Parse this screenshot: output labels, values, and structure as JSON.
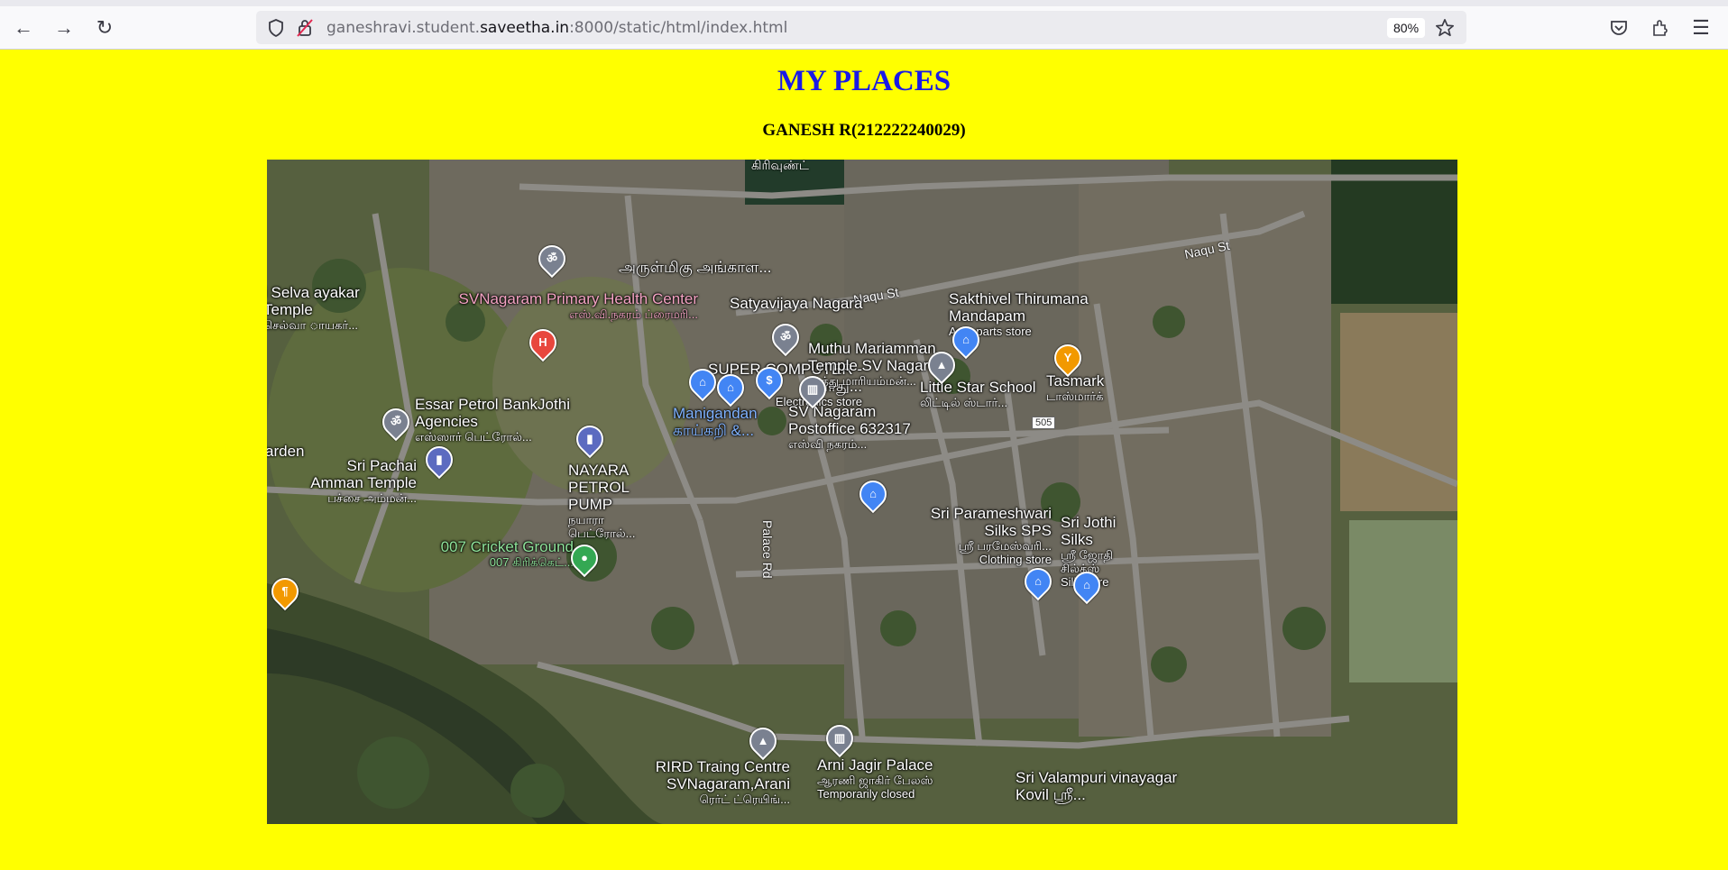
{
  "browser": {
    "url_prefix": "ganeshravi.student.",
    "url_domain": "saveetha.in",
    "url_suffix": ":8000/static/html/index.html",
    "zoom": "80%"
  },
  "page": {
    "title": "MY PLACES",
    "subtitle": "GANESH R(212222240029)"
  },
  "map": {
    "places": [
      {
        "name": "அருள்மிகு அங்காள...",
        "icon": "temple"
      },
      {
        "name": "SVNagaram Primary Health Center",
        "local": "எஸ்.வி.நகரம் ப்ரைமரி...",
        "icon": "hospital"
      },
      {
        "name": "Satyavijaya Nagara",
        "icon": "none"
      },
      {
        "name": "SUPER COMPUTER - பொது...",
        "category": "Electronics store",
        "icon": "shop"
      },
      {
        "name": "Muthu Mariamman Temple SV Nagaram",
        "local": "முத்து மாரியம்மன்...",
        "icon": "temple"
      },
      {
        "name": "Sakthivel Thirumana Mandapam",
        "category": "Auto parts store",
        "icon": "shop"
      },
      {
        "name": "Tasmark",
        "local": "டாஸ்மார்க்",
        "icon": "bar"
      },
      {
        "name": "Little Star School",
        "local": "லிட்டில் ஸ்டார்...",
        "icon": "school"
      },
      {
        "name": "Manigandan காய்கறி &...",
        "icon": "shop"
      },
      {
        "name": "SV Nagaram Postoffice 632317",
        "local": "எஸ்வி நகரம்...",
        "icon": "bank"
      },
      {
        "name": "Essar Petrol BankJothi Agencies",
        "local": "எஸ்ஸார் பெட்ரோல்...",
        "icon": "fuel"
      },
      {
        "name": "Sri Pachai Amman Temple",
        "local": "பச்சை அம்மன்...",
        "icon": "temple"
      },
      {
        "name": "NAYARA PETROL PUMP",
        "local": "நயாரா பெட்ரோல்...",
        "icon": "fuel"
      },
      {
        "name": "007 Cricket Ground",
        "local": "007 கிரிக்கெட்...",
        "icon": "park"
      },
      {
        "name": "Sri Parameshwari Silks SPS",
        "local": "ஸ்ரீ பரமேஸ்வரி...",
        "category": "Clothing store",
        "icon": "shop"
      },
      {
        "name": "Sri Jothi Silks",
        "local": "ஸ்ரீ ஜோதி சில்க்ஸ்",
        "category": "Silk store",
        "icon": "shop"
      },
      {
        "name": "RIRD Traing Centre SVNagaram,Arani",
        "local": "ரெர்ட் ட்ரெயிங்...",
        "icon": "school"
      },
      {
        "name": "Arni Jagir Palace",
        "local": "ஆரணி ஜாகிர் பேலஸ்",
        "category": "Temporarily closed",
        "icon": "landmark"
      },
      {
        "name": "Sri Valampuri vinayagar Kovil ஸ்ரீ...",
        "icon": "temple"
      },
      {
        "name": "i Selva ayakar Temple",
        "local": "செல்வா ாயகர்...",
        "icon": "temple"
      },
      {
        "name": "arden",
        "icon": "none"
      }
    ],
    "roads": [
      "Naqu St",
      "Naqu St",
      "Palace Rd",
      "505",
      "கிரிவுண்ட்"
    ]
  }
}
